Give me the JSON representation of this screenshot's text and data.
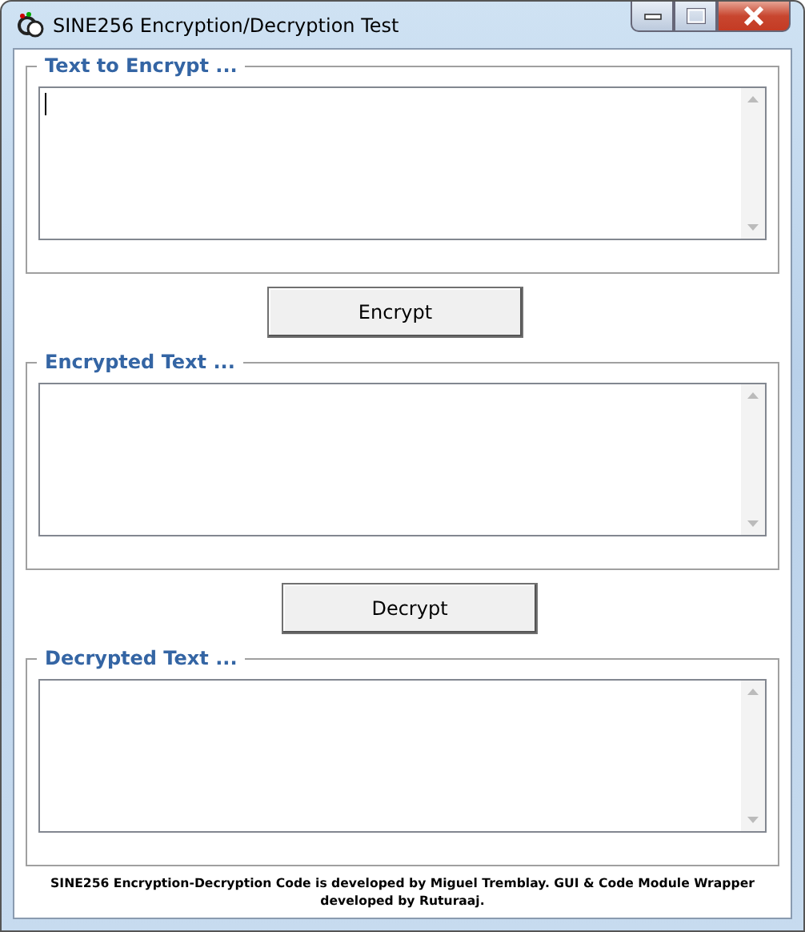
{
  "window": {
    "title": "SINE256 Encryption/Decryption Test"
  },
  "sections": [
    {
      "kind": "group",
      "legend": "Text to Encrypt ...",
      "focused": true
    },
    {
      "kind": "button",
      "label": "Encrypt"
    },
    {
      "kind": "group",
      "legend": "Encrypted Text ...",
      "focused": false
    },
    {
      "kind": "button",
      "label": "Decrypt"
    },
    {
      "kind": "group",
      "legend": "Decrypted Text ...",
      "focused": false
    }
  ],
  "footer": "SINE256 Encryption-Decryption Code is developed by Miguel Tremblay. GUI & Code Module Wrapper developed by Ruturaaj."
}
